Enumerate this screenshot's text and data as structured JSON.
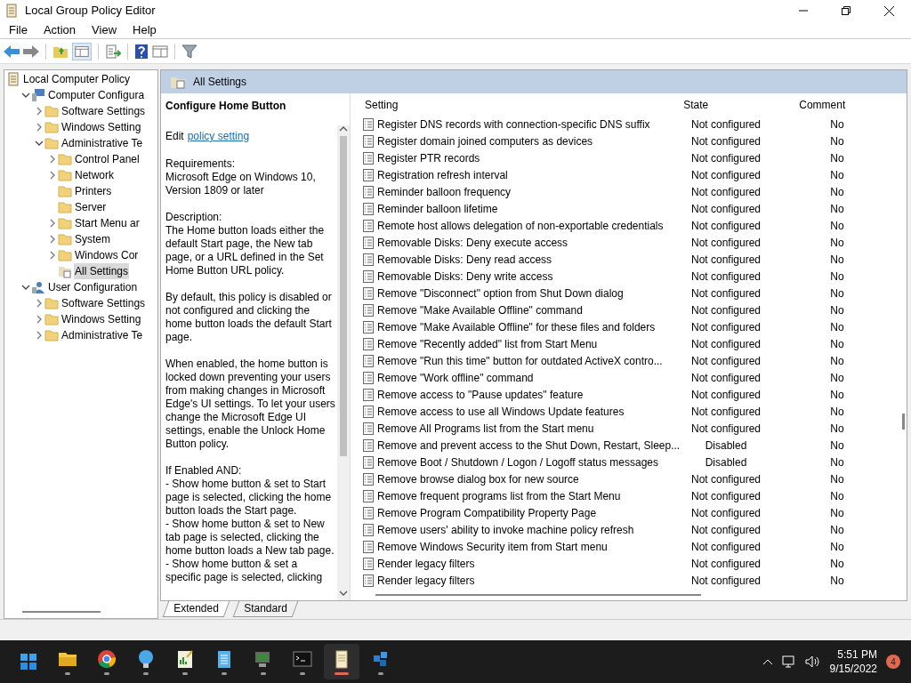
{
  "window": {
    "title": "Local Group Policy Editor"
  },
  "menu": [
    "File",
    "Action",
    "View",
    "Help"
  ],
  "tree": [
    {
      "label": "Local Computer Policy",
      "kind": "root",
      "selected": false,
      "children": [
        {
          "label": "Computer Configura",
          "kind": "computer",
          "expanded": true,
          "selected": false,
          "children": [
            {
              "label": "Software Settings",
              "kind": "folder",
              "expanded": false,
              "selected": false
            },
            {
              "label": "Windows Setting",
              "kind": "folder",
              "expanded": false,
              "selected": false
            },
            {
              "label": "Administrative Te",
              "kind": "folder",
              "expanded": true,
              "selected": false,
              "children": [
                {
                  "label": "Control Panel",
                  "kind": "folder",
                  "expanded": false,
                  "selected": false
                },
                {
                  "label": "Network",
                  "kind": "folder",
                  "expanded": false,
                  "selected": false
                },
                {
                  "label": "Printers",
                  "kind": "folder",
                  "selected": false
                },
                {
                  "label": "Server",
                  "kind": "folder",
                  "selected": false
                },
                {
                  "label": "Start Menu ar",
                  "kind": "folder",
                  "expanded": false,
                  "selected": false
                },
                {
                  "label": "System",
                  "kind": "folder",
                  "expanded": false,
                  "selected": false
                },
                {
                  "label": "Windows Cor",
                  "kind": "folder",
                  "expanded": false,
                  "selected": false
                },
                {
                  "label": "All Settings",
                  "kind": "list",
                  "selected": true
                }
              ]
            }
          ]
        },
        {
          "label": "User Configuration",
          "kind": "user",
          "expanded": true,
          "selected": false,
          "children": [
            {
              "label": "Software Settings",
              "kind": "folder",
              "expanded": false,
              "selected": false
            },
            {
              "label": "Windows Setting",
              "kind": "folder",
              "expanded": false,
              "selected": false
            },
            {
              "label": "Administrative Te",
              "kind": "folder",
              "expanded": false,
              "selected": false
            }
          ]
        }
      ]
    }
  ],
  "pane_header": "All Settings",
  "description": {
    "title": "Configure Home Button",
    "edit_prefix": "Edit",
    "edit_link": "policy setting",
    "paragraphs": [
      "Requirements:\nMicrosoft Edge on Windows 10, Version 1809 or later",
      "Description:\nThe Home button loads either the default Start page, the New tab page, or a URL defined in the Set Home Button URL policy.",
      "By default, this policy is disabled or not configured and clicking the home button loads the default Start page.",
      "When enabled, the home button is locked down preventing your users from making changes in Microsoft Edge's UI settings. To let your users change the Microsoft Edge UI settings, enable the Unlock Home Button policy.",
      "If Enabled AND:\n- Show home button & set to Start page is selected, clicking the home button loads the Start page.\n- Show home button & set to New tab page is selected, clicking the home button loads a New tab page.\n- Show home button & set a specific page is selected, clicking"
    ]
  },
  "table": {
    "columns": [
      "Setting",
      "State",
      "Comment"
    ],
    "rows": [
      {
        "setting": "Register DNS records with connection-specific DNS suffix",
        "state": "Not configured",
        "comment": "No"
      },
      {
        "setting": "Register domain joined computers as devices",
        "state": "Not configured",
        "comment": "No"
      },
      {
        "setting": "Register PTR records",
        "state": "Not configured",
        "comment": "No"
      },
      {
        "setting": "Registration refresh interval",
        "state": "Not configured",
        "comment": "No"
      },
      {
        "setting": "Reminder balloon frequency",
        "state": "Not configured",
        "comment": "No"
      },
      {
        "setting": "Reminder balloon lifetime",
        "state": "Not configured",
        "comment": "No"
      },
      {
        "setting": "Remote host allows delegation of non-exportable credentials",
        "state": "Not configured",
        "comment": "No"
      },
      {
        "setting": "Removable Disks: Deny execute access",
        "state": "Not configured",
        "comment": "No"
      },
      {
        "setting": "Removable Disks: Deny read access",
        "state": "Not configured",
        "comment": "No"
      },
      {
        "setting": "Removable Disks: Deny write access",
        "state": "Not configured",
        "comment": "No"
      },
      {
        "setting": "Remove \"Disconnect\" option from Shut Down dialog",
        "state": "Not configured",
        "comment": "No"
      },
      {
        "setting": "Remove \"Make Available Offline\" command",
        "state": "Not configured",
        "comment": "No"
      },
      {
        "setting": "Remove \"Make Available Offline\" for these files and folders",
        "state": "Not configured",
        "comment": "No"
      },
      {
        "setting": "Remove \"Recently added\" list from Start Menu",
        "state": "Not configured",
        "comment": "No"
      },
      {
        "setting": "Remove \"Run this time\" button for outdated ActiveX contro...",
        "state": "Not configured",
        "comment": "No"
      },
      {
        "setting": "Remove \"Work offline\" command",
        "state": "Not configured",
        "comment": "No"
      },
      {
        "setting": "Remove access to \"Pause updates\" feature",
        "state": "Not configured",
        "comment": "No"
      },
      {
        "setting": "Remove access to use all Windows Update features",
        "state": "Not configured",
        "comment": "No"
      },
      {
        "setting": "Remove All Programs list from the Start menu",
        "state": "Not configured",
        "comment": "No"
      },
      {
        "setting": "Remove and prevent access to the Shut Down, Restart, Sleep...",
        "state": "Disabled",
        "comment": "No"
      },
      {
        "setting": "Remove Boot / Shutdown / Logon / Logoff status messages",
        "state": "Disabled",
        "comment": "No"
      },
      {
        "setting": "Remove browse dialog box for new source",
        "state": "Not configured",
        "comment": "No"
      },
      {
        "setting": "Remove frequent programs list from the Start Menu",
        "state": "Not configured",
        "comment": "No"
      },
      {
        "setting": "Remove Program Compatibility Property Page",
        "state": "Not configured",
        "comment": "No"
      },
      {
        "setting": "Remove users' ability to invoke machine policy refresh",
        "state": "Not configured",
        "comment": "No"
      },
      {
        "setting": "Remove Windows Security item from Start menu",
        "state": "Not configured",
        "comment": "No"
      },
      {
        "setting": "Render legacy filters",
        "state": "Not configured",
        "comment": "No"
      },
      {
        "setting": "Render legacy filters",
        "state": "Not configured",
        "comment": "No"
      }
    ]
  },
  "view_tabs": [
    {
      "label": "Extended",
      "selected": true
    },
    {
      "label": "Standard",
      "selected": false
    }
  ],
  "taskbar": {
    "apps": [
      {
        "kind": "start",
        "active": false
      },
      {
        "kind": "explorer",
        "active": false
      },
      {
        "kind": "chrome",
        "active": false
      },
      {
        "kind": "bulb",
        "active": false
      },
      {
        "kind": "chart",
        "active": false
      },
      {
        "kind": "notepad",
        "active": false
      },
      {
        "kind": "monitor",
        "active": false
      },
      {
        "kind": "terminal",
        "active": false
      },
      {
        "kind": "policy",
        "active": true
      },
      {
        "kind": "cubes",
        "active": false
      }
    ],
    "time": "5:51 PM",
    "date": "9/15/2022",
    "notifications": "4"
  }
}
